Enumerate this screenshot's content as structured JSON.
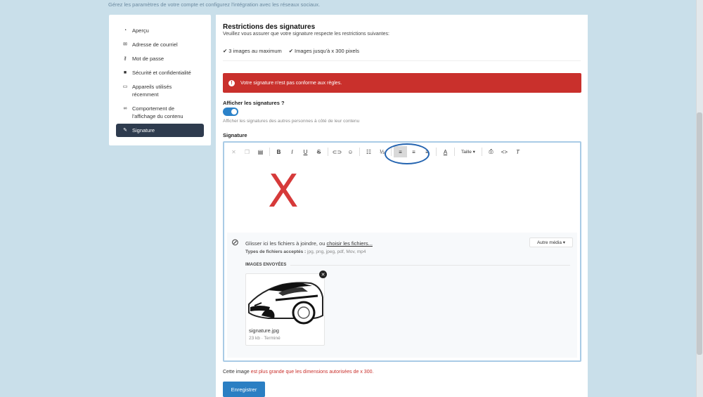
{
  "header": {
    "subtitle": "Gérez les paramètres de votre compte et configurez l'intégration avec les réseaux sociaux."
  },
  "sidebar": {
    "items": [
      {
        "label": "Aperçu",
        "icon": "dashboard-icon"
      },
      {
        "label": "Adresse de courriel",
        "icon": "envelope-icon"
      },
      {
        "label": "Mot de passe",
        "icon": "key-icon"
      },
      {
        "label": "Sécurité et confidentialité",
        "icon": "lock-icon"
      },
      {
        "label": "Appareils utilisés récemment",
        "icon": "laptop-icon"
      },
      {
        "label": "Comportement de l'affichage du contenu",
        "icon": "link-icon"
      },
      {
        "label": "Signature",
        "icon": "pencil-icon",
        "active": true
      }
    ]
  },
  "restrictions": {
    "title": "Restrictions des signatures",
    "description": "Veuillez vous assurer que votre signature respecte les restrictions suivantes:",
    "rule1": "3 images au maximum",
    "rule2": "Images jusqu'à x 300 pixels"
  },
  "alert": {
    "message": "Votre signature n'est pas conforme aux règles.",
    "color": "#c9302c"
  },
  "show_signatures": {
    "label": "Afficher les signatures ?",
    "enabled": true,
    "help": "Afficher les signatures des autres personnes à côté de leur contenu"
  },
  "signature": {
    "label": "Signature",
    "toolbar": {
      "size_label": "Taille"
    },
    "attach": {
      "drop_text": "Glisser ici les fichiers à joindre, ou",
      "choose_link": "choisir les fichiers...",
      "types_label": "Types de fichiers acceptés :",
      "types_value": "jpg, png, jpeg, pdf, Mov, mp4",
      "other_media": "Autre média",
      "uploaded_label": "IMAGES ENVOYÉES",
      "file": {
        "name": "signature.jpg",
        "meta": "23 kb · Terminé"
      }
    }
  },
  "error": {
    "prefix": "Cette image",
    "rest": "est plus grande que les dimensions autorisées de x 300."
  },
  "save_label": "Enregistrer",
  "colors": {
    "accent": "#2b7fc3",
    "alert": "#c9302c",
    "nav_active": "#2e3b4e"
  }
}
